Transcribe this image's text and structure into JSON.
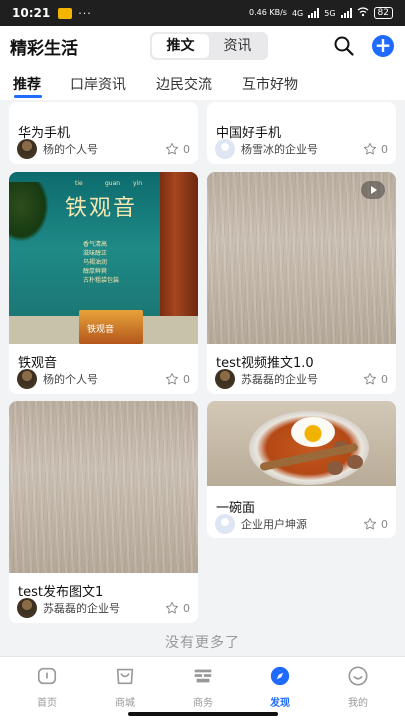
{
  "status_bar": {
    "time": "10:21",
    "network_speed": "0.46 KB/s",
    "network_type": "4G",
    "signal": "5G",
    "battery": "82"
  },
  "header": {
    "title": "精彩生活",
    "segments": [
      "推文",
      "资讯"
    ],
    "active_segment": "推文"
  },
  "tabs": [
    "推荐",
    "口岸资讯",
    "边民交流",
    "互市好物"
  ],
  "active_tab": "推荐",
  "cards": [
    {
      "title": "华为手机",
      "author": "杨的个人号",
      "likes": "0"
    },
    {
      "title": "中国好手机",
      "author": "杨雪冰的企业号",
      "likes": "0"
    },
    {
      "title": "铁观音",
      "author": "杨的个人号",
      "likes": "0",
      "image_text": {
        "pinyin": [
          "tie",
          "guan",
          "yin"
        ],
        "name": "铁观音",
        "lines": [
          "香气清高",
          "滋味醇正",
          "乌褐油润",
          "醇厚鲜爽",
          "古朴粗袋包装"
        ],
        "box_label": "铁观音"
      }
    },
    {
      "title": "test视频推文1.0",
      "author": "苏磊磊的企业号",
      "likes": "0",
      "is_video": true
    },
    {
      "title": "test发布图文1",
      "author": "苏磊磊的企业号",
      "likes": "0"
    },
    {
      "title": "一碗面",
      "author": "企业用户坤源",
      "likes": "0"
    }
  ],
  "footer_text": "没有更多了",
  "bottom_nav": [
    {
      "label": "首页",
      "icon": "home-icon"
    },
    {
      "label": "商城",
      "icon": "shop-icon"
    },
    {
      "label": "商务",
      "icon": "business-icon"
    },
    {
      "label": "发现",
      "icon": "compass-icon"
    },
    {
      "label": "我的",
      "icon": "profile-icon"
    }
  ],
  "active_nav": "发现",
  "colors": {
    "accent": "#1f6bff",
    "background": "#f2f3f5"
  }
}
